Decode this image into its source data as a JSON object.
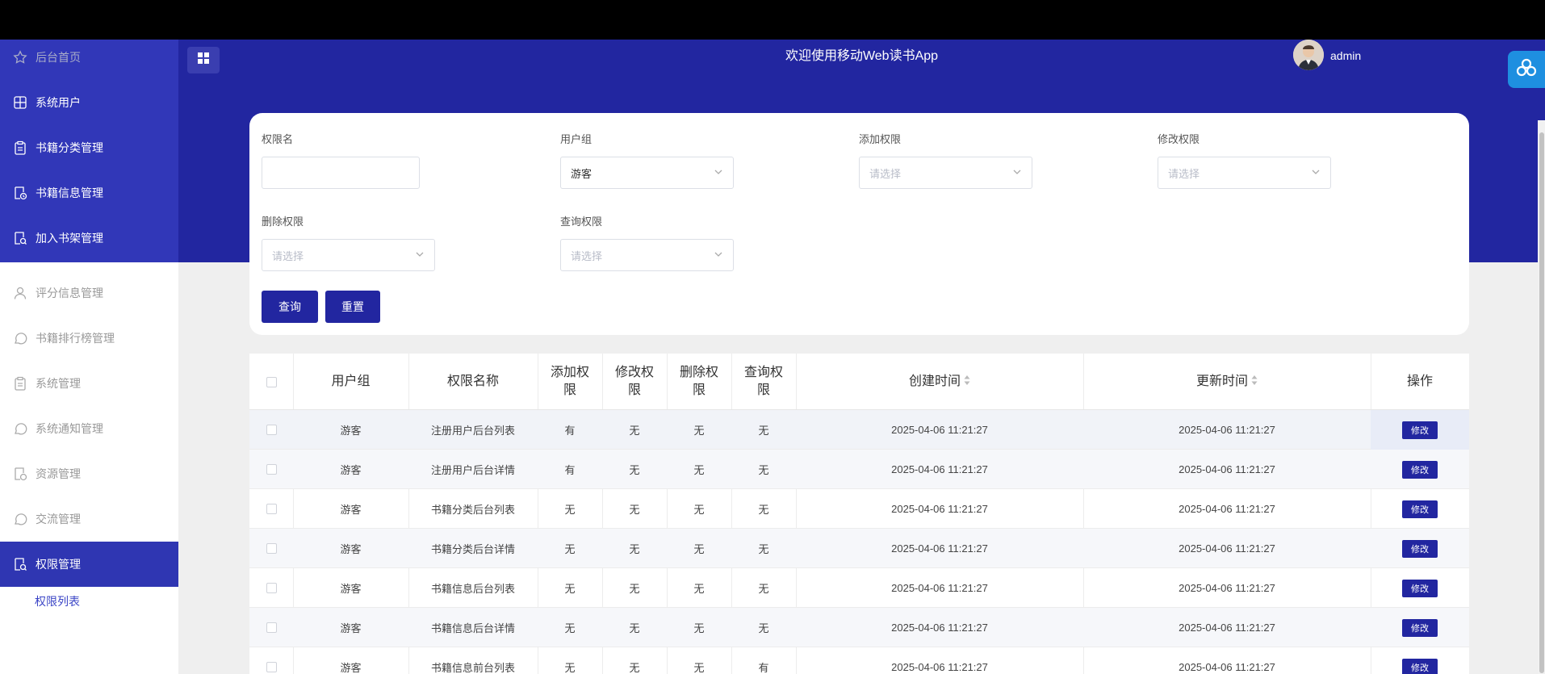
{
  "app": {
    "title": "欢迎使用移动Web读书App",
    "user": "admin"
  },
  "colors": {
    "primary": "#2226a0",
    "sidebar_active": "#3137b8",
    "accent": "#3b45c6"
  },
  "sidebar": {
    "items": [
      {
        "label": "后台首页",
        "icon": "star-icon"
      },
      {
        "label": "系统用户",
        "icon": "grid-icon"
      },
      {
        "label": "书籍分类管理",
        "icon": "clipboard-icon"
      },
      {
        "label": "书籍信息管理",
        "icon": "doc-clock-icon"
      },
      {
        "label": "加入书架管理",
        "icon": "doc-search-icon"
      },
      {
        "label": "评分信息管理",
        "icon": "user-icon"
      },
      {
        "label": "书籍排行榜管理",
        "icon": "chat-icon"
      },
      {
        "label": "系统管理",
        "icon": "clipboard-icon"
      },
      {
        "label": "系统通知管理",
        "icon": "chat-icon"
      },
      {
        "label": "资源管理",
        "icon": "doc-clock-icon"
      },
      {
        "label": "交流管理",
        "icon": "chat-icon"
      },
      {
        "label": "权限管理",
        "icon": "doc-search-icon"
      }
    ],
    "sub_item": "权限列表"
  },
  "search": {
    "perm_name_label": "权限名",
    "perm_name_value": "",
    "user_group_label": "用户组",
    "user_group_value": "游客",
    "add_perm_label": "添加权限",
    "edit_perm_label": "修改权限",
    "delete_perm_label": "删除权限",
    "query_perm_label": "查询权限",
    "placeholder": "请选择",
    "query_button": "查询",
    "reset_button": "重置"
  },
  "table": {
    "headers": {
      "user_group": "用户组",
      "perm_name": "权限名称",
      "add": "添加权限",
      "edit": "修改权限",
      "delete": "删除权限",
      "query": "查询权限",
      "created": "创建时间",
      "updated": "更新时间",
      "actions": "操作"
    },
    "edit_label": "修改",
    "rows": [
      {
        "group": "游客",
        "name": "注册用户后台列表",
        "add": "有",
        "edit": "无",
        "delete": "无",
        "query": "无",
        "created": "2025-04-06 11:21:27",
        "updated": "2025-04-06 11:21:27"
      },
      {
        "group": "游客",
        "name": "注册用户后台详情",
        "add": "有",
        "edit": "无",
        "delete": "无",
        "query": "无",
        "created": "2025-04-06 11:21:27",
        "updated": "2025-04-06 11:21:27"
      },
      {
        "group": "游客",
        "name": "书籍分类后台列表",
        "add": "无",
        "edit": "无",
        "delete": "无",
        "query": "无",
        "created": "2025-04-06 11:21:27",
        "updated": "2025-04-06 11:21:27"
      },
      {
        "group": "游客",
        "name": "书籍分类后台详情",
        "add": "无",
        "edit": "无",
        "delete": "无",
        "query": "无",
        "created": "2025-04-06 11:21:27",
        "updated": "2025-04-06 11:21:27"
      },
      {
        "group": "游客",
        "name": "书籍信息后台列表",
        "add": "无",
        "edit": "无",
        "delete": "无",
        "query": "无",
        "created": "2025-04-06 11:21:27",
        "updated": "2025-04-06 11:21:27"
      },
      {
        "group": "游客",
        "name": "书籍信息后台详情",
        "add": "无",
        "edit": "无",
        "delete": "无",
        "query": "无",
        "created": "2025-04-06 11:21:27",
        "updated": "2025-04-06 11:21:27"
      },
      {
        "group": "游客",
        "name": "书籍信息前台列表",
        "add": "无",
        "edit": "无",
        "delete": "无",
        "query": "有",
        "created": "2025-04-06 11:21:27",
        "updated": "2025-04-06 11:21:27"
      }
    ]
  }
}
